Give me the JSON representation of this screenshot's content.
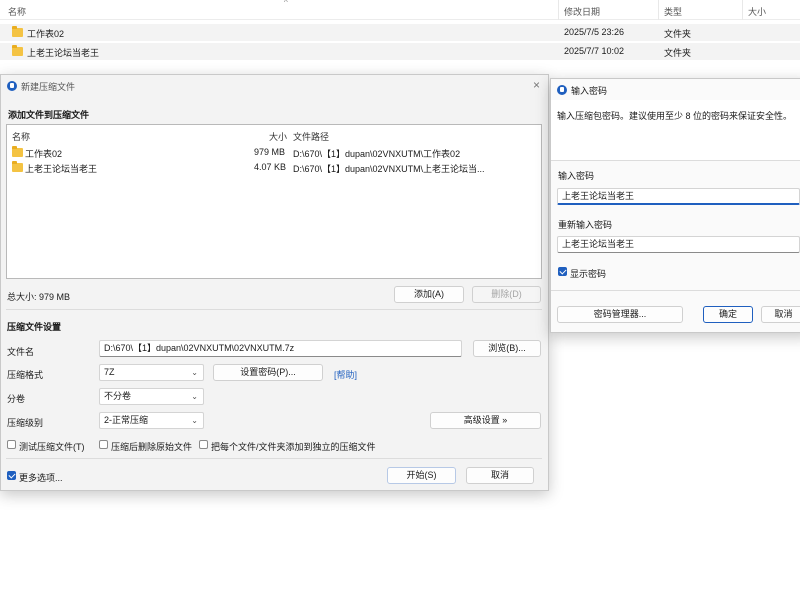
{
  "explorer": {
    "headers": {
      "name": "名称",
      "modified": "修改日期",
      "type": "类型",
      "size": "大小"
    },
    "rows": [
      {
        "name": "工作表02",
        "modified": "2025/7/5 23:26",
        "type": "文件夹"
      },
      {
        "name": "上老王论坛当老王",
        "modified": "2025/7/7 10:02",
        "type": "文件夹"
      }
    ]
  },
  "archive_dialog": {
    "title": "新建压缩文件",
    "add_files_heading": "添加文件到压缩文件",
    "list_headers": {
      "name": "名称",
      "size": "大小",
      "path": "文件路径"
    },
    "files": [
      {
        "name": "工作表02",
        "size": "979 MB",
        "path": "D:\\670\\【1】dupan\\02VNXUTM\\工作表02"
      },
      {
        "name": "上老王论坛当老王",
        "size": "4.07 KB",
        "path": "D:\\670\\【1】dupan\\02VNXUTM\\上老王论坛当..."
      }
    ],
    "total_size": "总大小: 979 MB",
    "add_button": "添加(A)",
    "delete_button": "删除(D)",
    "settings_heading": "压缩文件设置",
    "filename_label": "文件名",
    "filename_value": "D:\\670\\【1】dupan\\02VNXUTM\\02VNXUTM.7z",
    "browse_button": "浏览(B)...",
    "format_label": "压缩格式",
    "format_value": "7Z",
    "set_password_button": "设置密码(P)...",
    "help_link": "[帮助]",
    "volume_label": "分卷",
    "volume_value": "不分卷",
    "level_label": "压缩级别",
    "level_value": "2-正常压缩",
    "advanced_button": "高级设置 »",
    "test_checkbox": "测试压缩文件(T)",
    "delete_after_checkbox": "压缩后删除原始文件",
    "separate_checkbox": "把每个文件/文件夹添加到独立的压缩文件",
    "more_options_checkbox": "更多选项...",
    "start_button": "开始(S)",
    "cancel_button": "取消"
  },
  "password_dialog": {
    "title": "输入密码",
    "description": "输入压缩包密码。建议使用至少 8 位的密码来保证安全性。",
    "password_label": "输入密码",
    "password_value": "上老王论坛当老王",
    "confirm_label": "重新输入密码",
    "confirm_value": "上老王论坛当老王",
    "show_password": "显示密码",
    "manager_button": "密码管理器...",
    "ok_button": "确定",
    "cancel_button": "取消"
  }
}
